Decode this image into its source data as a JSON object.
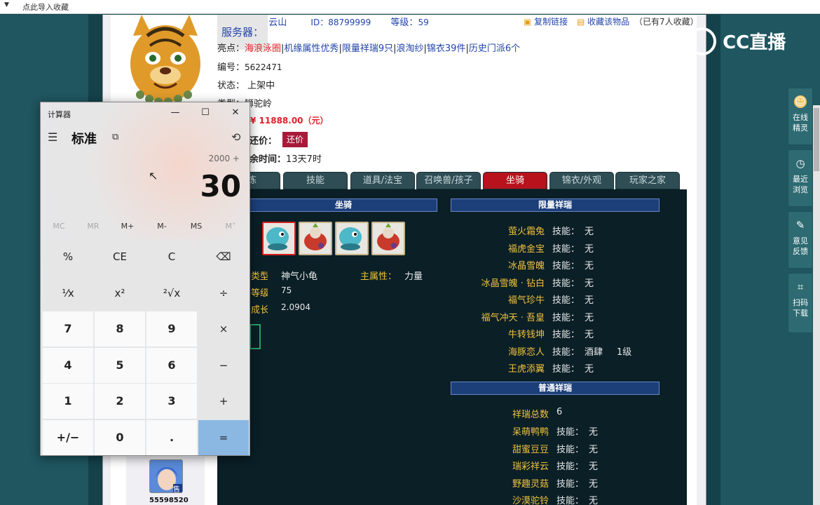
{
  "topbar": {
    "label": "点此导入收藏"
  },
  "item": {
    "server_label": "服务器：",
    "server": "广东4区一日云山",
    "id_label": "ID：",
    "id": "88799999",
    "level_label": "等级：",
    "level": "59",
    "copy_link": "复制链接",
    "favorite": "收藏该物品",
    "fav_count": "（已有7人收藏）",
    "highlights_label": "亮点：",
    "highlights": [
      "海浪泳圈",
      "机缘属性优秀",
      "限量祥瑞9只",
      "浪淘纱",
      "锦衣39件",
      "历史门派6个"
    ],
    "number_label": "编号：",
    "number": "5622471",
    "status_label": "状态：",
    "status": "上架中",
    "type_label": "类型：",
    "type": "狮驼岭",
    "price": "¥ 11888.00（元）",
    "bargain_label": "还价：",
    "bargain_button": "还价",
    "time_label": "余时间：",
    "time": "13天7时"
  },
  "tabs": [
    "修炼",
    "技能",
    "道具/法宝",
    "召唤兽/孩子",
    "坐骑",
    "锦衣/外观",
    "玩家之家"
  ],
  "active_tab": 4,
  "mount": {
    "header": "坐骑",
    "type_label": "类型：",
    "type": "神气小龟",
    "main_attr_label": "主属性：",
    "main_attr": "力量",
    "level_label": "等级：",
    "level": "75",
    "growth_label": "成长：",
    "growth": "2.0904"
  },
  "limited": {
    "header": "限量祥瑞",
    "skill_label": "技能：",
    "items": [
      {
        "name": "萤火霜兔",
        "skill": "无",
        "lvl": ""
      },
      {
        "name": "福虎金宝",
        "skill": "无",
        "lvl": ""
      },
      {
        "name": "冰晶雪魄",
        "skill": "无",
        "lvl": ""
      },
      {
        "name": "冰晶雪魄 · 钻白",
        "skill": "无",
        "lvl": ""
      },
      {
        "name": "福气珍牛",
        "skill": "无",
        "lvl": ""
      },
      {
        "name": "福气冲天 · 吾皇",
        "skill": "无",
        "lvl": ""
      },
      {
        "name": "牛转钱坤",
        "skill": "无",
        "lvl": ""
      },
      {
        "name": "海豚恋人",
        "skill": "酒肆",
        "lvl": "1级"
      },
      {
        "name": "王虎添翼",
        "skill": "无",
        "lvl": ""
      }
    ]
  },
  "normal": {
    "header": "普通祥瑞",
    "total_label": "祥瑞总数",
    "total": "6",
    "skill_label": "技能：",
    "items": [
      {
        "name": "呆萌鸭鸭",
        "skill": "无"
      },
      {
        "name": "甜蜜豆豆",
        "skill": "无"
      },
      {
        "name": "瑞彩祥云",
        "skill": "无"
      },
      {
        "name": "野趣灵菇",
        "skill": "无"
      },
      {
        "name": "沙漠驼铃",
        "skill": "无"
      }
    ]
  },
  "seller": {
    "id": "55598520",
    "badge": "售"
  },
  "watermark": "CC直播",
  "sidebar": [
    {
      "label1": "在线",
      "label2": "精灵"
    },
    {
      "label1": "最近",
      "label2": "浏览"
    },
    {
      "label1": "意见",
      "label2": "反馈"
    },
    {
      "label1": "扫码",
      "label2": "下载"
    }
  ],
  "calculator": {
    "title": "计算器",
    "mode": "标准",
    "expression": "2000 +",
    "display": "30",
    "memory": [
      "MC",
      "MR",
      "M+",
      "M-",
      "MS",
      "M˅"
    ],
    "keys": [
      [
        "%",
        "CE",
        "C",
        "⌫"
      ],
      [
        "¹⁄x",
        "x²",
        "²√x",
        "÷"
      ],
      [
        "7",
        "8",
        "9",
        "×"
      ],
      [
        "4",
        "5",
        "6",
        "−"
      ],
      [
        "1",
        "2",
        "3",
        "+"
      ],
      [
        "+/−",
        "0",
        ".",
        "="
      ]
    ]
  }
}
